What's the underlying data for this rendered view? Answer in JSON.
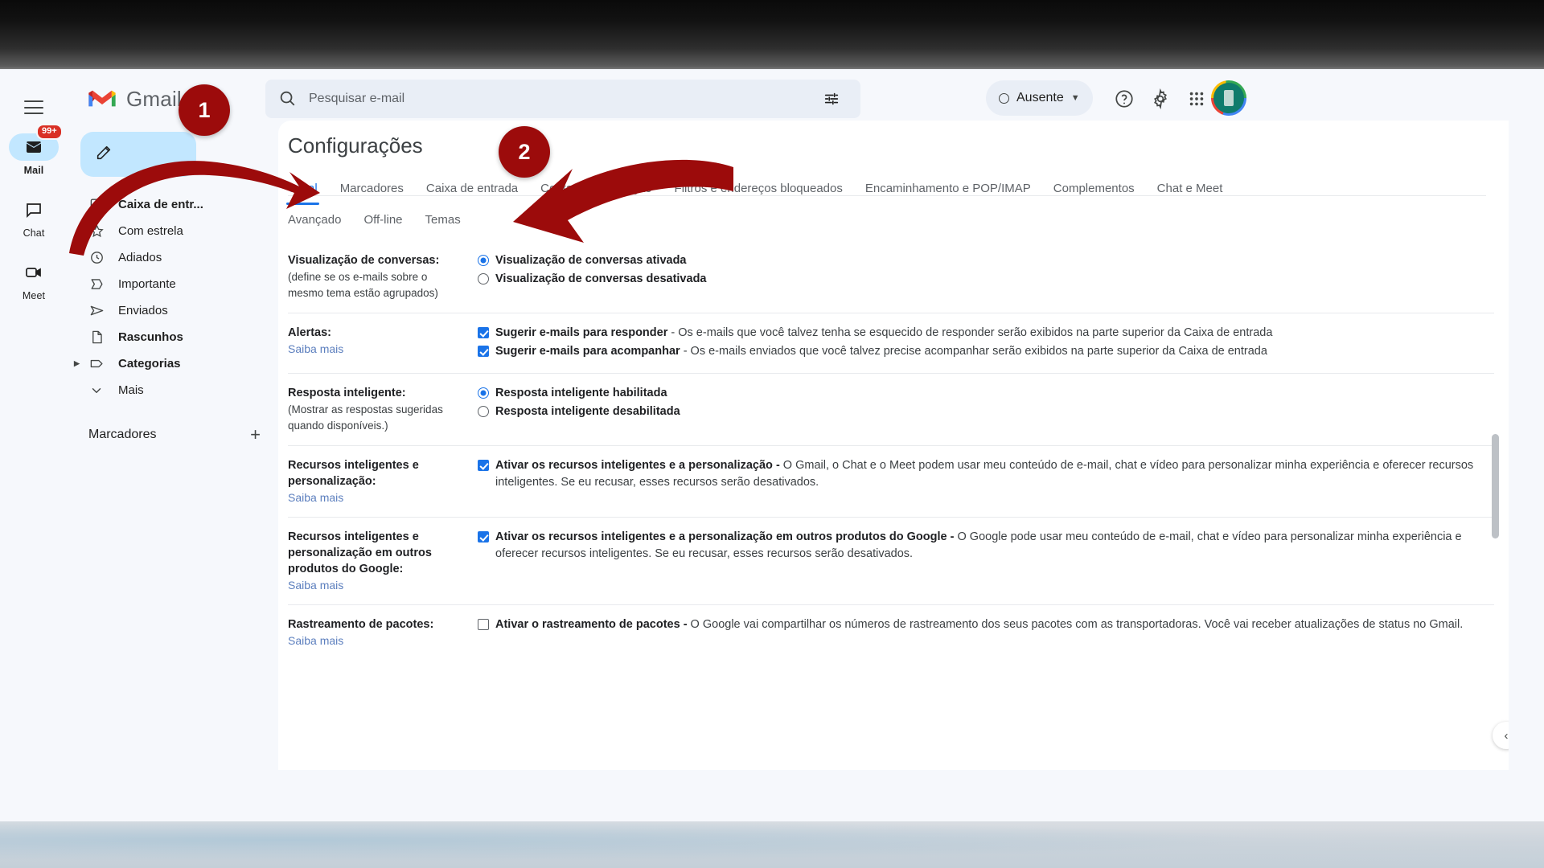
{
  "window": {
    "app_title": "Gmail"
  },
  "rail": {
    "hamburger_icon": "hamburger-menu-icon",
    "items": [
      {
        "id": "mail",
        "label": "Mail",
        "icon": "mail-inbox-icon",
        "badge": "99+",
        "active": true
      },
      {
        "id": "chat",
        "label": "Chat",
        "icon": "chat-bubble-icon",
        "badge": "",
        "active": false
      },
      {
        "id": "meet",
        "label": "Meet",
        "icon": "video-camera-icon",
        "badge": "",
        "active": false
      }
    ]
  },
  "sidebar": {
    "brand": "Gmail",
    "brand_icon": "gmail-m-logo-icon",
    "compose_icon": "pencil-compose-icon",
    "items": [
      {
        "label": "Caixa de entr...",
        "icon": "inbox-icon",
        "bold": true,
        "caret": false
      },
      {
        "label": "Com estrela",
        "icon": "star-icon",
        "bold": false,
        "caret": false
      },
      {
        "label": "Adiados",
        "icon": "clock-icon",
        "bold": false,
        "caret": false
      },
      {
        "label": "Importante",
        "icon": "important-label-icon",
        "bold": false,
        "caret": false
      },
      {
        "label": "Enviados",
        "icon": "send-icon",
        "bold": false,
        "caret": false
      },
      {
        "label": "Rascunhos",
        "icon": "draft-file-icon",
        "bold": true,
        "caret": false
      },
      {
        "label": "Categorias",
        "icon": "tag-icon",
        "bold": true,
        "caret": true
      },
      {
        "label": "Mais",
        "icon": "chevron-down-icon",
        "bold": false,
        "caret": false
      }
    ],
    "labels_title": "Marcadores",
    "add_label_icon": "plus-icon"
  },
  "header": {
    "search_icon": "search-icon",
    "search_value": "",
    "search_placeholder": "Pesquisar e-mail",
    "tune_icon": "search-options-tune-icon",
    "status": {
      "text": "Ausente",
      "dot_icon": "status-away-circle-icon",
      "chevron_icon": "chevron-down-icon"
    },
    "help_icon": "help-question-icon",
    "settings_icon": "gear-icon",
    "apps_icon": "google-apps-grid-icon",
    "avatar_icon": "user-avatar-icon"
  },
  "settings": {
    "title": "Configurações",
    "tabs_row1": [
      {
        "label": "Geral",
        "active": true
      },
      {
        "label": "Marcadores",
        "active": false
      },
      {
        "label": "Caixa de entrada",
        "active": false
      },
      {
        "label": "Contas e importação",
        "active": false
      },
      {
        "label": "Filtros e endereços bloqueados",
        "active": false
      },
      {
        "label": "Encaminhamento e POP/IMAP",
        "active": false
      },
      {
        "label": "Complementos",
        "active": false
      },
      {
        "label": "Chat e Meet",
        "active": false
      }
    ],
    "tabs_row2": [
      {
        "label": "Avançado",
        "active": false
      },
      {
        "label": "Off-line",
        "active": false
      },
      {
        "label": "Temas",
        "active": false
      }
    ],
    "rows": [
      {
        "id": "conversation-view",
        "label_main": "Visualização de conversas:",
        "label_sub": "(define se os e-mails sobre o mesmo tema estão agrupados)",
        "label_link": "",
        "control": "radio",
        "options": [
          {
            "checked": true,
            "bold": "Visualização de conversas ativada",
            "rest": ""
          },
          {
            "checked": false,
            "bold": "Visualização de conversas desativada",
            "rest": ""
          }
        ]
      },
      {
        "id": "alerts",
        "label_main": "Alertas:",
        "label_sub": "",
        "label_link": "Saiba mais",
        "control": "checkbox",
        "options": [
          {
            "checked": true,
            "bold": "Sugerir e-mails para responder",
            "rest": " - Os e-mails que você talvez tenha se esquecido de responder serão exibidos na parte superior da Caixa de entrada"
          },
          {
            "checked": true,
            "bold": "Sugerir e-mails para acompanhar",
            "rest": " - Os e-mails enviados que você talvez precise acompanhar serão exibidos na parte superior da Caixa de entrada"
          }
        ]
      },
      {
        "id": "smart-reply",
        "label_main": "Resposta inteligente:",
        "label_sub": "(Mostrar as respostas sugeridas quando disponíveis.)",
        "label_link": "",
        "control": "radio",
        "options": [
          {
            "checked": true,
            "bold": "Resposta inteligente habilitada",
            "rest": ""
          },
          {
            "checked": false,
            "bold": "Resposta inteligente desabilitada",
            "rest": ""
          }
        ]
      },
      {
        "id": "smart-features",
        "label_main": "Recursos inteligentes e personalização:",
        "label_sub": "",
        "label_link": "Saiba mais",
        "control": "checkbox",
        "options": [
          {
            "checked": true,
            "bold": "Ativar os recursos inteligentes e a personalização -",
            "rest": " O Gmail, o Chat e o Meet podem usar meu conteúdo de e-mail, chat e vídeo para personalizar minha experiência e oferecer recursos inteligentes. Se eu recusar, esses recursos serão desativados."
          }
        ]
      },
      {
        "id": "smart-features-other-products",
        "label_main": "Recursos inteligentes e personalização em outros produtos do Google:",
        "label_sub": "",
        "label_link": "Saiba mais",
        "control": "checkbox",
        "options": [
          {
            "checked": true,
            "bold": "Ativar os recursos inteligentes e a personalização em outros produtos do Google -",
            "rest": " O Google pode usar meu conteúdo de e-mail, chat e vídeo para personalizar minha experiência e oferecer recursos inteligentes. Se eu recusar, esses recursos serão desativados."
          }
        ]
      },
      {
        "id": "package-tracking",
        "label_main": "Rastreamento de pacotes:",
        "label_sub": "",
        "label_link": "Saiba mais",
        "control": "checkbox",
        "options": [
          {
            "checked": false,
            "bold": "Ativar o rastreamento de pacotes -",
            "rest": " O Google vai compartilhar os números de rastreamento dos seus pacotes com as transportadoras. Você vai receber atualizações de status no Gmail."
          }
        ]
      }
    ],
    "collapse_icon": "chevron-left-icon"
  },
  "annotations": {
    "color": "#9c0b0b",
    "markers": [
      {
        "id": "1",
        "label": "1"
      },
      {
        "id": "2",
        "label": "2"
      }
    ]
  }
}
